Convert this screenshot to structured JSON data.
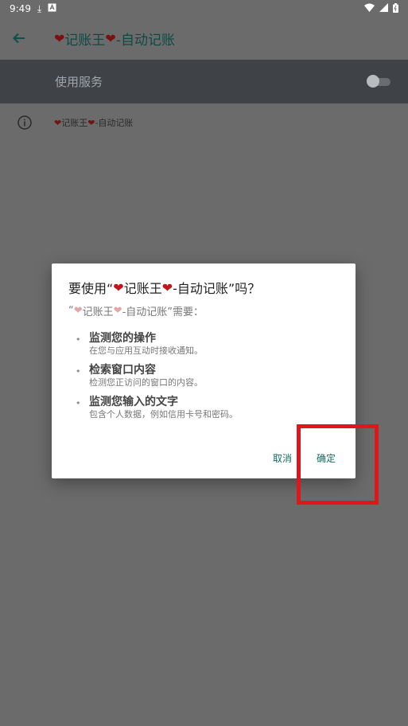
{
  "status_bar": {
    "time": "9:49",
    "icons": [
      "download-icon",
      "a-badge-icon",
      "wifi-icon",
      "signal-icon",
      "battery-icon"
    ]
  },
  "toolbar": {
    "title_heart_1": "❤",
    "title_part_1": "记账王",
    "title_heart_2": "❤",
    "title_part_2": "-自动记账"
  },
  "service_switch": {
    "label": "使用服务",
    "state": "off"
  },
  "info": {
    "heart_1": "❤",
    "part_1": "记账王",
    "heart_2": "❤",
    "part_2": "-自动记账"
  },
  "dialog": {
    "title_prefix": "要使用“",
    "title_heart_1": "❤",
    "title_app_1": "记账王",
    "title_heart_2": "❤",
    "title_app_2": "-自动记账",
    "title_suffix": "”吗？",
    "sub_prefix": "“",
    "sub_heart_1": "❤",
    "sub_app_1": "记账王",
    "sub_heart_2": "❤",
    "sub_app_2": "-自动记账",
    "sub_suffix": "”需要：",
    "permissions": [
      {
        "bullet": "•",
        "title": "监测您的操作",
        "desc": "在您与应用互动时接收通知。"
      },
      {
        "bullet": "•",
        "title": "检索窗口内容",
        "desc": "检测您正访问的窗口的内容。"
      },
      {
        "bullet": "•",
        "title": "监测您输入的文字",
        "desc": "包含个人数据，例如信用卡号和密码。"
      }
    ],
    "cancel_label": "取消",
    "ok_label": "确定"
  },
  "colors": {
    "scrim_background": "#6b6b6b",
    "switch_bar": "#3f4348",
    "accent": "#0f6d63",
    "highlight": "#e0161c"
  }
}
